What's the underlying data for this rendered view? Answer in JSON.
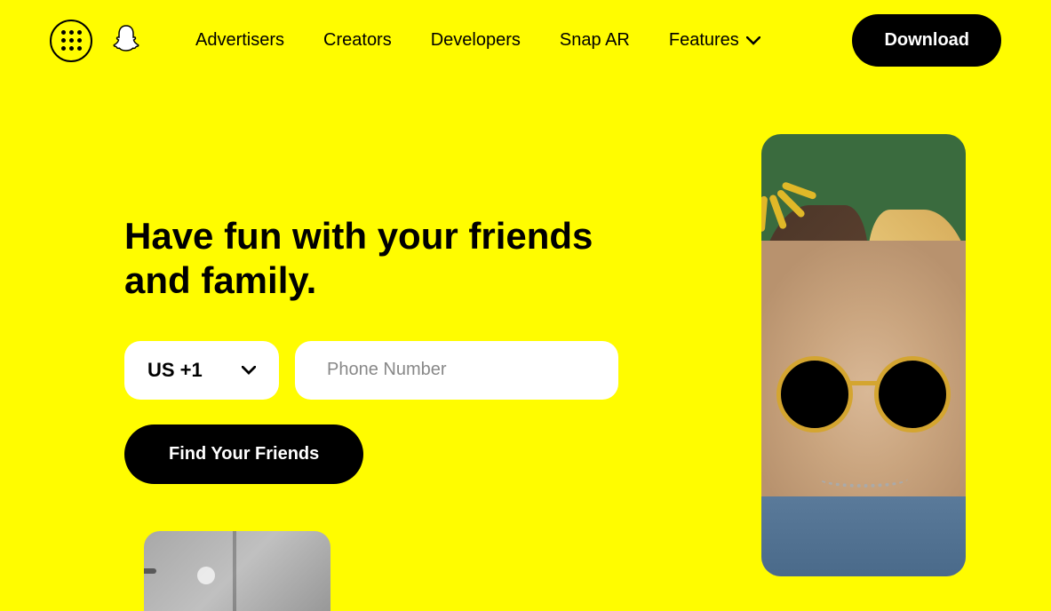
{
  "header": {
    "nav": [
      "Advertisers",
      "Creators",
      "Developers",
      "Snap AR",
      "Features"
    ],
    "download_label": "Download"
  },
  "hero": {
    "heading": "Have fun with your friends and family.",
    "country_code": "US +1",
    "phone_placeholder": "Phone Number",
    "cta_label": "Find Your Friends"
  }
}
